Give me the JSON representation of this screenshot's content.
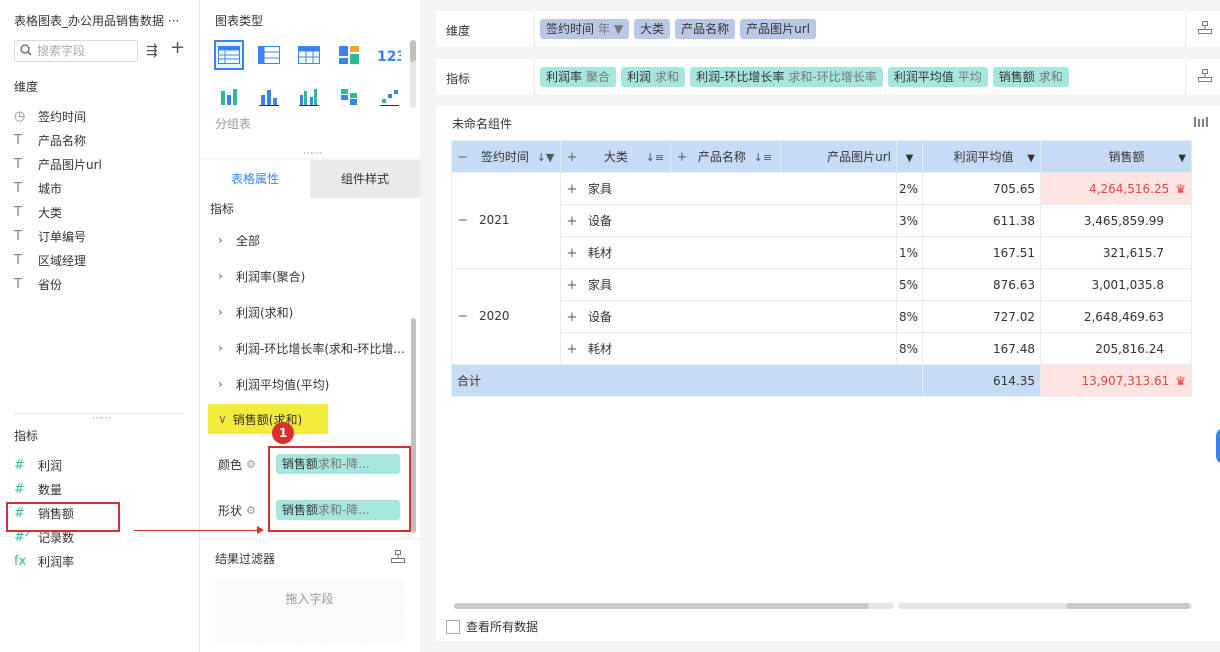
{
  "left": {
    "title": "表格图表_办公用品销售数据 ···",
    "search_placeholder": "搜索字段",
    "dimension_label": "维度",
    "dimensions": [
      {
        "icon": "clock-icon",
        "glyph": "◷",
        "label": "签约时间"
      },
      {
        "icon": "text-field-icon",
        "glyph": "T",
        "label": "产品名称"
      },
      {
        "icon": "text-field-icon",
        "glyph": "T",
        "label": "产品图片url"
      },
      {
        "icon": "text-field-icon",
        "glyph": "T",
        "label": "城市"
      },
      {
        "icon": "text-field-icon",
        "glyph": "T",
        "label": "大类"
      },
      {
        "icon": "text-field-icon",
        "glyph": "T",
        "label": "订单编号"
      },
      {
        "icon": "text-field-icon",
        "glyph": "T",
        "label": "区域经理"
      },
      {
        "icon": "text-field-icon",
        "glyph": "T",
        "label": "省份"
      }
    ],
    "measure_label": "指标",
    "measures": [
      {
        "icon": "number-field-icon",
        "glyph": "#",
        "label": "利润"
      },
      {
        "icon": "number-field-icon",
        "glyph": "#",
        "label": "数量"
      },
      {
        "icon": "number-field-icon",
        "glyph": "#",
        "label": "销售额"
      },
      {
        "icon": "record-count-icon",
        "glyph": "#ᐟ",
        "label": "记录数"
      },
      {
        "icon": "formula-icon",
        "glyph": "fx",
        "label": "利润率"
      }
    ]
  },
  "mid": {
    "chart_type_label": "图表类型",
    "group_label": "分组表",
    "tabs": [
      "表格属性",
      "组件样式"
    ],
    "indicator_label": "指标",
    "props": [
      "全部",
      "利润率(聚合)",
      "利润(求和)",
      "利润-环比增长率(求和-环比增...",
      "利润平均值(平均)"
    ],
    "active_prop": "销售额(求和)",
    "color_label": "颜色",
    "shape_label": "形状",
    "color_pill": {
      "main": "销售额",
      "sub": "求和-降..."
    },
    "shape_pill": {
      "main": "销售额",
      "sub": "求和-降..."
    },
    "filter_title": "结果过滤器",
    "filter_drop": "拖入字段"
  },
  "right": {
    "dim_label": "维度",
    "dim_chips": [
      {
        "main": "签约时间",
        "sub": "年 ▼"
      },
      {
        "main": "大类",
        "sub": ""
      },
      {
        "main": "产品名称",
        "sub": ""
      },
      {
        "main": "产品图片url",
        "sub": ""
      }
    ],
    "msr_label": "指标",
    "msr_chips": [
      {
        "main": "利润率",
        "sub": "聚合"
      },
      {
        "main": "利润",
        "sub": "求和"
      },
      {
        "main": "利润-环比增长率",
        "sub": "求和-环比增长率"
      },
      {
        "main": "利润平均值",
        "sub": "平均"
      },
      {
        "main": "销售额",
        "sub": "求和"
      }
    ],
    "widget_title": "未命名组件",
    "view_all": "查看所有数据",
    "annotation_number": "1"
  },
  "table": {
    "headers": {
      "c1": "签约时间",
      "c2": "大类",
      "c3": "产品名称",
      "c4": "产品图片url",
      "c5": "利润平均值",
      "c6": "销售额"
    },
    "rows": [
      {
        "year": "2021",
        "cat": "家具",
        "pct": "2%",
        "avg": "705.65",
        "sales": "4,264,516.25",
        "hl": true
      },
      {
        "year": "",
        "cat": "设备",
        "pct": "3%",
        "avg": "611.38",
        "sales": "3,465,859.99",
        "hl": false
      },
      {
        "year": "",
        "cat": "耗材",
        "pct": "1%",
        "avg": "167.51",
        "sales": "321,615.7",
        "hl": false
      },
      {
        "year": "2020",
        "cat": "家具",
        "pct": "5%",
        "avg": "876.63",
        "sales": "3,001,035.8",
        "hl": false
      },
      {
        "year": "",
        "cat": "设备",
        "pct": "8%",
        "avg": "727.02",
        "sales": "2,648,469.63",
        "hl": false
      },
      {
        "year": "",
        "cat": "耗材",
        "pct": "8%",
        "avg": "167.48",
        "sales": "205,816.24",
        "hl": false
      }
    ],
    "total": {
      "label": "合计",
      "avg": "614.35",
      "sales": "13,907,313.61"
    }
  }
}
